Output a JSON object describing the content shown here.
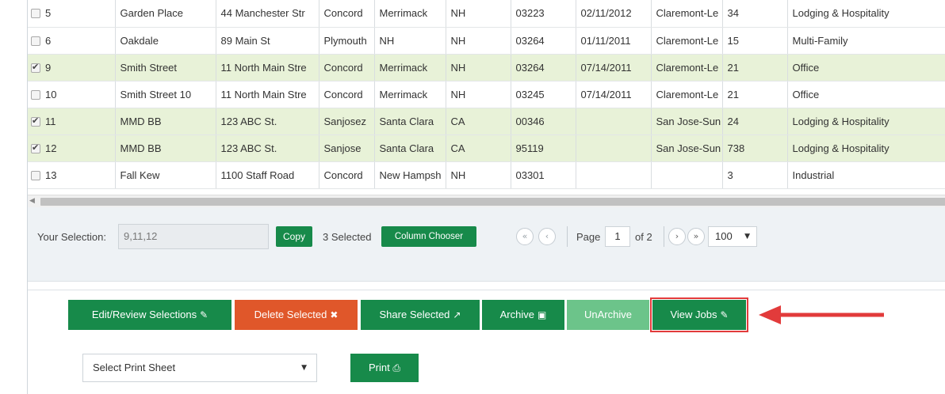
{
  "table": {
    "rows": [
      {
        "id": "5",
        "checked": false,
        "cells": [
          "Garden Place",
          "44 Manchester Str",
          "Concord",
          "Merrimack",
          "NH",
          "03223",
          "02/11/2012",
          "Claremont-Le",
          "34",
          "Lodging & Hospitality"
        ]
      },
      {
        "id": "6",
        "checked": false,
        "cells": [
          "Oakdale",
          "89 Main St",
          "Plymouth",
          "NH",
          "NH",
          "03264",
          "01/11/2011",
          "Claremont-Le",
          "15",
          "Multi-Family"
        ]
      },
      {
        "id": "9",
        "checked": true,
        "cells": [
          "Smith Street",
          "11 North Main Stre",
          "Concord",
          "Merrimack",
          "NH",
          "03264",
          "07/14/2011",
          "Claremont-Le",
          "21",
          "Office"
        ]
      },
      {
        "id": "10",
        "checked": false,
        "cells": [
          "Smith Street 10",
          "11 North Main Stre",
          "Concord",
          "Merrimack",
          "NH",
          "03245",
          "07/14/2011",
          "Claremont-Le",
          "21",
          "Office"
        ]
      },
      {
        "id": "11",
        "checked": true,
        "cells": [
          "MMD BB",
          "123 ABC St.",
          "Sanjosez",
          "Santa Clara",
          "CA",
          "00346",
          "",
          "San Jose-Sun",
          "24",
          "Lodging & Hospitality"
        ]
      },
      {
        "id": "12",
        "checked": true,
        "cells": [
          "MMD BB",
          "123 ABC St.",
          "Sanjose",
          "Santa Clara",
          "CA",
          "95119",
          "",
          "San Jose-Sun",
          "738",
          "Lodging & Hospitality"
        ]
      },
      {
        "id": "13",
        "checked": false,
        "cells": [
          "Fall Kew",
          "1100 Staff Road",
          "Concord",
          "New Hampsh",
          "NH",
          "03301",
          "",
          "",
          "3",
          "Industrial"
        ]
      }
    ]
  },
  "selection": {
    "label": "Your Selection:",
    "value": "9,11,12",
    "copy_label": "Copy",
    "count_label": "3 Selected",
    "column_chooser_label": "Column Chooser"
  },
  "pager": {
    "first_icon": "«",
    "prev_icon": "‹",
    "next_icon": "›",
    "last_icon": "»",
    "page_label": "Page",
    "page_value": "1",
    "of_label": "of 2",
    "per_page": "100",
    "caret": "▼"
  },
  "actions": {
    "edit_label": "Edit/Review Selections",
    "edit_icon": "✎",
    "delete_label": "Delete Selected",
    "delete_icon": "✖",
    "share_label": "Share Selected",
    "share_icon": "↗",
    "archive_label": "Archive",
    "archive_icon": "▣",
    "unarchive_label": "UnArchive",
    "viewjobs_label": "View Jobs",
    "viewjobs_icon": "✎"
  },
  "print": {
    "select_label": "Select Print Sheet",
    "caret": "▼",
    "print_label": "Print",
    "print_icon": "⎙"
  },
  "colors": {
    "green": "#178a4a",
    "orange": "#e0572a",
    "light_green": "#6cc48a",
    "selected_row": "#e8f2d8",
    "annotation_red": "#e23b3b"
  }
}
